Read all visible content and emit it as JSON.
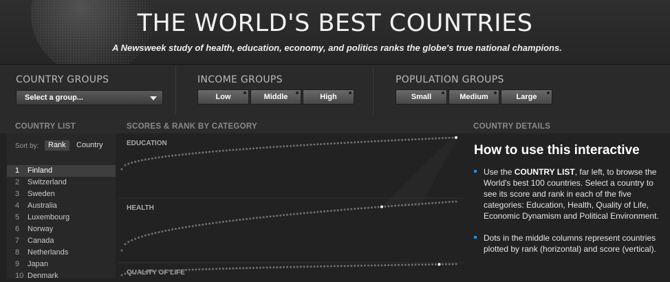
{
  "header": {
    "title": "THE WORLD'S BEST COUNTRIES",
    "subtitle": "A Newsweek study of health, education, economy, and politics ranks the globe's true national champions."
  },
  "filters": {
    "country_groups": {
      "label": "COUNTRY GROUPS",
      "select_value": "Select a group..."
    },
    "income_groups": {
      "label": "INCOME GROUPS",
      "buttons": [
        "Low",
        "Middle",
        "High"
      ]
    },
    "population_groups": {
      "label": "POPULATION GROUPS",
      "buttons": [
        "Small",
        "Medium",
        "Large"
      ]
    }
  },
  "country_list": {
    "heading": "COUNTRY LIST",
    "sort_by_label": "Sort by:",
    "sort_rank": "Rank",
    "sort_country": "Country",
    "selected_index": 0,
    "items": [
      {
        "rank": "1",
        "name": "Finland"
      },
      {
        "rank": "2",
        "name": "Switzerland"
      },
      {
        "rank": "3",
        "name": "Sweden"
      },
      {
        "rank": "4",
        "name": "Australia"
      },
      {
        "rank": "5",
        "name": "Luxembourg"
      },
      {
        "rank": "6",
        "name": "Norway"
      },
      {
        "rank": "7",
        "name": "Canada"
      },
      {
        "rank": "8",
        "name": "Netherlands"
      },
      {
        "rank": "9",
        "name": "Japan"
      },
      {
        "rank": "10",
        "name": "Denmark"
      }
    ]
  },
  "scores": {
    "heading": "SCORES & RANK BY CATEGORY",
    "categories": [
      {
        "label": "EDUCATION",
        "highlight_rank": 1
      },
      {
        "label": "HEALTH",
        "highlight_rank": 23
      },
      {
        "label": "QUALITY OF LIFE",
        "highlight_rank": 6
      }
    ]
  },
  "details": {
    "heading": "COUNTRY DETAILS",
    "howto_title": "How to use this interactive",
    "bullet1_pre": "Use the ",
    "bullet1_bold": "COUNTRY LIST",
    "bullet1_post": ", far left, to browse the World's best 100 countries. Select a country to see its score and rank in each of the five categories: Education, Health, Quality of Life, Economic Dynamism and Political Environment.",
    "bullet2": "Dots in the middle columns represent countries plotted by rank (horizontal) and score (vertical)."
  },
  "colors": {
    "accent_bullet": "#2a8fd8",
    "dot": "#6e6e6e",
    "highlight_dot": "#ffffff"
  }
}
